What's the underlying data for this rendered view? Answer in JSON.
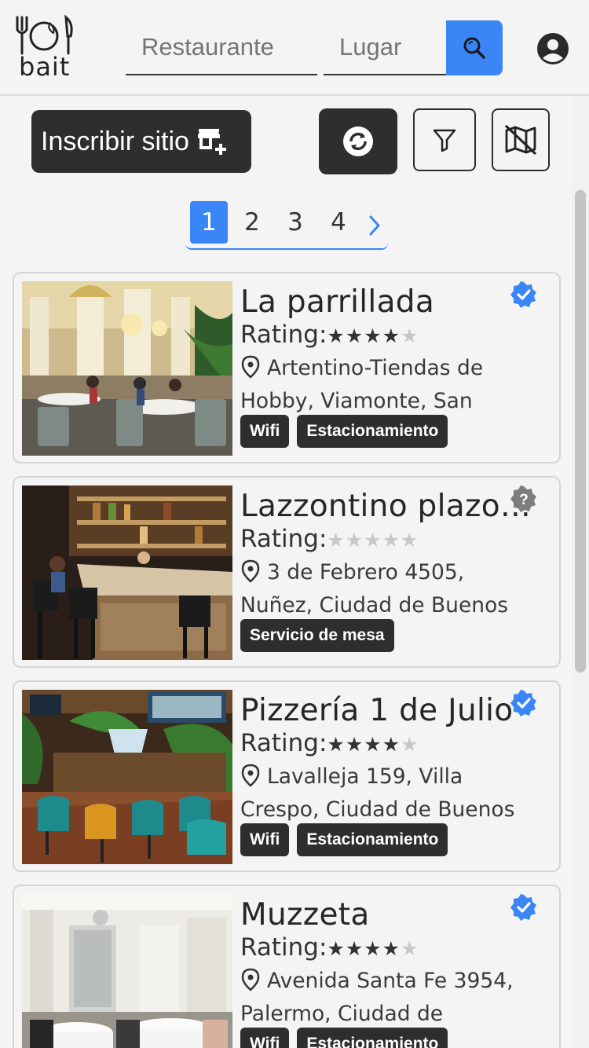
{
  "brand": {
    "logo_text": "bait"
  },
  "search": {
    "restaurant_placeholder": "Restaurante",
    "place_placeholder": "Lugar"
  },
  "toolbar": {
    "register_label": "Inscribir sitio"
  },
  "pagination": {
    "pages": [
      "1",
      "2",
      "3",
      "4"
    ],
    "current": "1"
  },
  "listing": {
    "rating_label": "Rating:",
    "items": [
      {
        "name": "La parrillada",
        "rating": 4,
        "address": "Artentino-Tiendas de Hobby, Viamonte, San",
        "tags": [
          "Wifi",
          "Estacionamiento"
        ],
        "verified": true
      },
      {
        "name": "Lazzontino plazoleta",
        "rating": 0,
        "address": "3 de Febrero 4505, Nuñez, Ciudad de Buenos",
        "tags": [
          "Servicio de mesa"
        ],
        "verified": false
      },
      {
        "name": "Pizzería 1 de Julio",
        "rating": 4,
        "address": "Lavalleja 159, Villa Crespo, Ciudad de Buenos",
        "tags": [
          "Wifi",
          "Estacionamiento"
        ],
        "verified": true
      },
      {
        "name": "Muzzeta",
        "rating": 4,
        "address": "Avenida Santa Fe 3954, Palermo, Ciudad de",
        "tags": [
          "Wifi",
          "Estacionamiento"
        ],
        "verified": true
      }
    ]
  },
  "icons": {
    "search": "search-icon",
    "user": "user-account-icon",
    "store_add": "store-add-icon",
    "refresh": "refresh-icon",
    "filter": "filter-icon",
    "map_off": "map-off-icon",
    "pin": "location-pin-icon",
    "verified": "verified-badge-icon",
    "unverified": "unverified-badge-icon",
    "next": "chevron-right-icon"
  },
  "colors": {
    "accent": "#3a86f7",
    "dark": "#2e2e2e",
    "background": "#f4f4f4"
  }
}
